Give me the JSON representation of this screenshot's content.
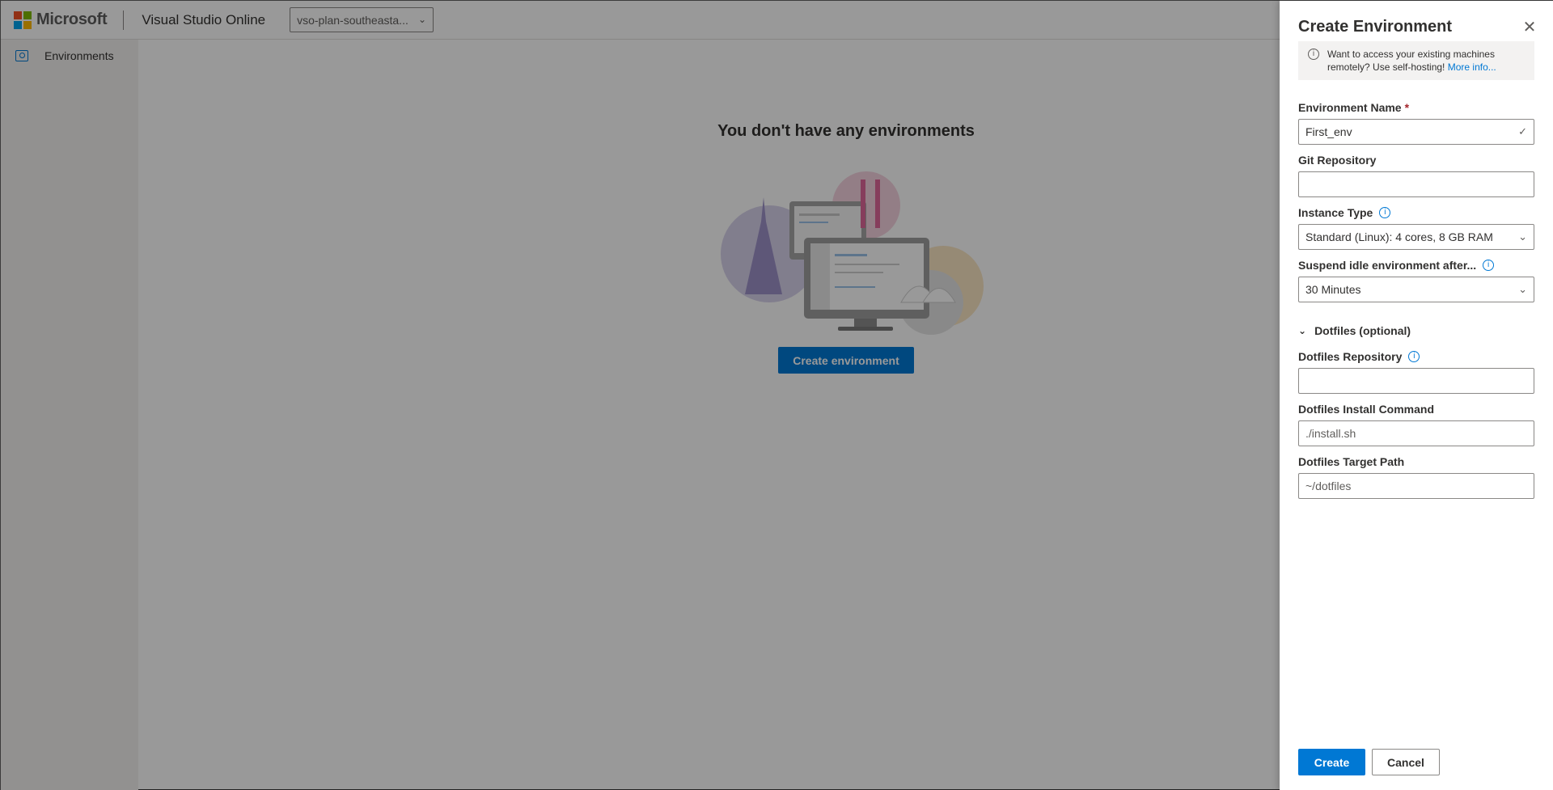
{
  "topbar": {
    "brand": "Microsoft",
    "product": "Visual Studio Online",
    "plan_select_value": "vso-plan-southeasta..."
  },
  "sidebar": {
    "items": [
      {
        "label": "Environments",
        "icon": "environments-icon"
      }
    ]
  },
  "main": {
    "empty_title": "You don't have any environments",
    "create_button": "Create environment"
  },
  "panel": {
    "title": "Create Environment",
    "info_text": "Want to access your existing machines remotely? Use self-hosting! ",
    "info_link": "More info...",
    "fields": {
      "env_name_label": "Environment Name",
      "env_name_required": "*",
      "env_name_value": "First_env",
      "git_repo_label": "Git Repository",
      "git_repo_value": "",
      "instance_type_label": "Instance Type",
      "instance_type_value": "Standard (Linux): 4 cores, 8 GB RAM",
      "suspend_label": "Suspend idle environment after...",
      "suspend_value": "30 Minutes",
      "dotfiles_section": "Dotfiles (optional)",
      "dotfiles_repo_label": "Dotfiles Repository",
      "dotfiles_repo_value": "",
      "dotfiles_install_label": "Dotfiles Install Command",
      "dotfiles_install_placeholder": "./install.sh",
      "dotfiles_target_label": "Dotfiles Target Path",
      "dotfiles_target_placeholder": "~/dotfiles"
    },
    "create_label": "Create",
    "cancel_label": "Cancel"
  },
  "colors": {
    "accent": "#0078d4",
    "overlay": "rgba(0,0,0,0.40)",
    "ms_red": "#f25022",
    "ms_green": "#7fba00",
    "ms_blue": "#00a4ef",
    "ms_yellow": "#ffb900"
  }
}
